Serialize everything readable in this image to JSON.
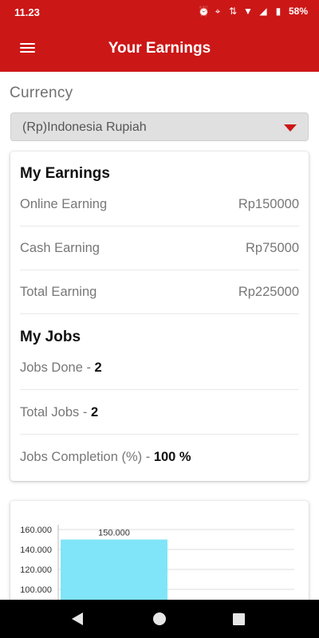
{
  "status_bar": {
    "time": "11.23",
    "battery": "58%",
    "icons": [
      "alarm-icon",
      "location-icon",
      "data-arrows-icon",
      "wifi-icon",
      "signal-icon",
      "battery-icon"
    ]
  },
  "app_bar": {
    "menu_icon": "hamburger-menu-icon",
    "title": "Your Earnings",
    "color": "#cc1717"
  },
  "currency": {
    "label": "Currency",
    "selected": "(Rp)Indonesia Rupiah"
  },
  "earnings": {
    "title": "My Earnings",
    "rows": [
      {
        "label": "Online Earning",
        "value": "Rp150000"
      },
      {
        "label": "Cash Earning",
        "value": "Rp75000"
      },
      {
        "label": "Total Earning",
        "value": "Rp225000"
      }
    ]
  },
  "jobs": {
    "title": "My Jobs",
    "rows": [
      {
        "label": "Jobs Done - ",
        "value": "2"
      },
      {
        "label": "Total Jobs - ",
        "value": "2"
      },
      {
        "label": "Jobs Completion (%) - ",
        "value": "100 %"
      }
    ]
  },
  "chart_data": {
    "type": "bar",
    "categories": [
      ""
    ],
    "values": [
      150000
    ],
    "data_labels": [
      "150.000"
    ],
    "y_ticks": [
      "100.000",
      "120.000",
      "140.000",
      "160.000"
    ],
    "y_tick_values": [
      100000,
      120000,
      140000,
      160000
    ],
    "ylim_visible": [
      100000,
      160000
    ],
    "bar_color": "#80e5f8",
    "grid": true
  },
  "nav_bar": {
    "icons": [
      "back-icon",
      "home-icon",
      "recents-icon"
    ]
  }
}
